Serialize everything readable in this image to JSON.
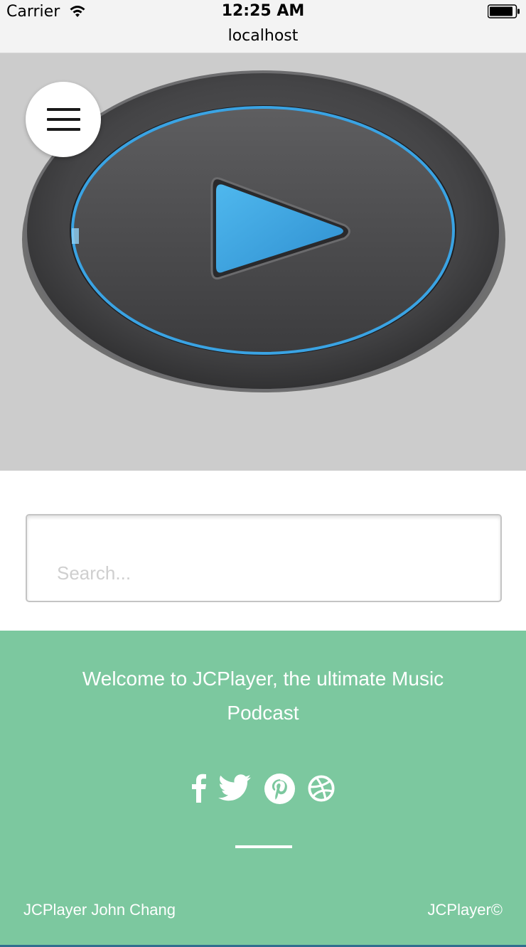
{
  "status_bar": {
    "carrier": "Carrier",
    "time": "12:25 AM",
    "url": "localhost",
    "icons": [
      "wifi-icon",
      "battery-icon"
    ]
  },
  "hero": {
    "image": "play-button-graphic",
    "accent_color": "#3aa3e3",
    "background": "#cccccc",
    "menu_icon": "hamburger-menu-icon"
  },
  "search": {
    "placeholder": "Search...",
    "value": ""
  },
  "footer": {
    "background": "#7cc89f",
    "welcome_text": "Welcome to JCPlayer, the ultimate Music Podcast",
    "social_icons": [
      "facebook-icon",
      "twitter-icon",
      "pinterest-icon",
      "dribbble-icon"
    ],
    "copyright_left": "JCPlayer John Chang",
    "copyright_right": "JCPlayer©"
  }
}
